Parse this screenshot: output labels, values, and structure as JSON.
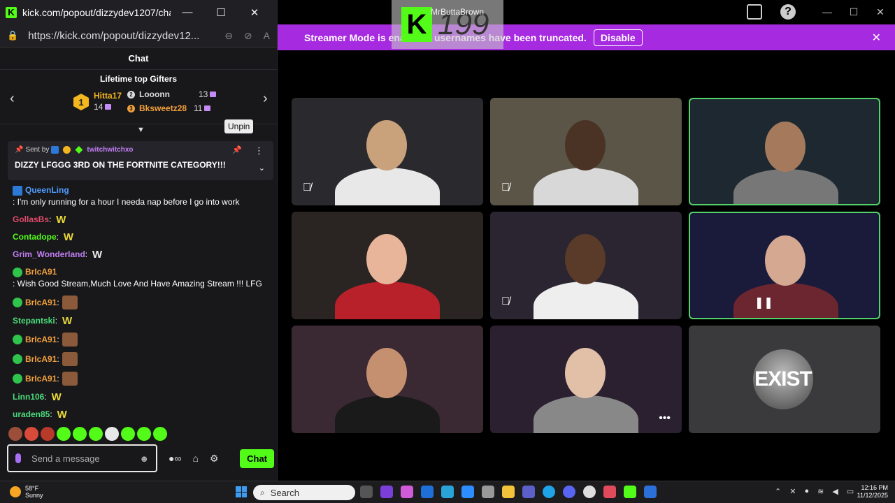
{
  "window": {
    "title": "kick.com/popout/dizzydev1207/chat -...",
    "url": "https://kick.com/popout/dizzydev12...",
    "minimize": "—",
    "maximize": "☐",
    "close": "✕"
  },
  "chat": {
    "header": "Chat",
    "gifters_title": "Lifetime top Gifters",
    "first_gifter": {
      "rank": "1",
      "name": "Hitta17",
      "count": "14"
    },
    "gifters": [
      {
        "rank": "2",
        "name": "Looonn",
        "count": "13",
        "color": "#dddddd"
      },
      {
        "rank": "3",
        "name": "Bksweetz28",
        "count": "11",
        "color": "#f2a03b"
      }
    ],
    "unpin_tooltip": "Unpin",
    "pinned": {
      "sent_by_label": "Sent by",
      "sender": "twitchwitchxo",
      "message": "DIZZY LFGGG 3RD ON THE FORTNITE CATEGORY!!!"
    },
    "messages": [
      {
        "user": "QueenLing",
        "color": "#4f9cff",
        "text": ": I'm only running for a hour I needa nap before I go into work",
        "badge": "sub",
        "emote": ""
      },
      {
        "user": "GollasBs",
        "color": "#e04a6a",
        "text": ":",
        "badge": "",
        "emote": "W"
      },
      {
        "user": "Contadope",
        "color": "#53fc18",
        "text": ":",
        "badge": "",
        "emote": "W"
      },
      {
        "user": "Grim_Wonderland",
        "color": "#c17ef2",
        "text": ":",
        "badge": "",
        "emote": "W"
      },
      {
        "user": "BrIcA91",
        "color": "#f2a03b",
        "text": ": Wish Good Stream,Much Love And Have Amazing Stream !!! LFG",
        "badge": "verified",
        "emote": ""
      },
      {
        "user": "BrIcA91",
        "color": "#f2a03b",
        "text": ":",
        "badge": "verified",
        "emote": "face"
      },
      {
        "user": "Stepantski",
        "color": "#4bdc7a",
        "text": ":",
        "badge": "",
        "emote": "W"
      },
      {
        "user": "BrIcA91",
        "color": "#f2a03b",
        "text": ":",
        "badge": "verified",
        "emote": "face"
      },
      {
        "user": "BrIcA91",
        "color": "#f2a03b",
        "text": ":",
        "badge": "verified",
        "emote": "face"
      },
      {
        "user": "BrIcA91",
        "color": "#f2a03b",
        "text": ":",
        "badge": "verified",
        "emote": "face"
      },
      {
        "user": "Linn106",
        "color": "#4bdc7a",
        "text": ":",
        "badge": "",
        "emote": "W"
      },
      {
        "user": "uraden85",
        "color": "#4bdc7a",
        "text": ":",
        "badge": "",
        "emote": "W"
      }
    ],
    "input_placeholder": "Send a message",
    "send_label": "Chat"
  },
  "banner": {
    "text": "Streamer Mode is enabled - usernames have been truncated.",
    "disable_label": "Disable"
  },
  "overlay": {
    "number": "199",
    "name": "MrButtaBrown"
  },
  "tiles": [
    {
      "bg": "#2a2a2e",
      "muted": true,
      "active": false,
      "face": "#c9a27c",
      "shirt": "#e8e8e8"
    },
    {
      "bg": "#5a5546",
      "muted": true,
      "active": false,
      "face": "#4a3324",
      "shirt": "#d8d8d8"
    },
    {
      "bg": "#1d2830",
      "muted": false,
      "active": true,
      "face": "#a57a5c",
      "shirt": "#777777"
    },
    {
      "bg": "#2a2422",
      "muted": false,
      "active": false,
      "face": "#e8b59a",
      "shirt": "#b8212a"
    },
    {
      "bg": "#2a2530",
      "muted": true,
      "active": false,
      "face": "#5a3a28",
      "shirt": "#eeeeee"
    },
    {
      "bg": "#1a1a3a",
      "muted": false,
      "active": true,
      "face": "#d4a891",
      "shirt": "#6b2630"
    },
    {
      "bg": "#3a2832",
      "muted": false,
      "active": false,
      "face": "#c49070",
      "shirt": "#1a1a1a"
    },
    {
      "bg": "#2a2030",
      "muted": false,
      "active": false,
      "face": "#e2c0a8",
      "shirt": "#888888"
    },
    {
      "bg": "#3a3a3c",
      "muted": false,
      "active": false,
      "face": "",
      "shirt": "",
      "logo": "EXIST"
    }
  ],
  "taskbar": {
    "temp": "58°F",
    "condition": "Sunny",
    "search_label": "Search",
    "time": "12:16 PM",
    "date": "11/12/2025"
  },
  "colors": {
    "kick_green": "#53fc18",
    "banner_purple": "#a62ae0",
    "active_border": "#53d26b"
  }
}
